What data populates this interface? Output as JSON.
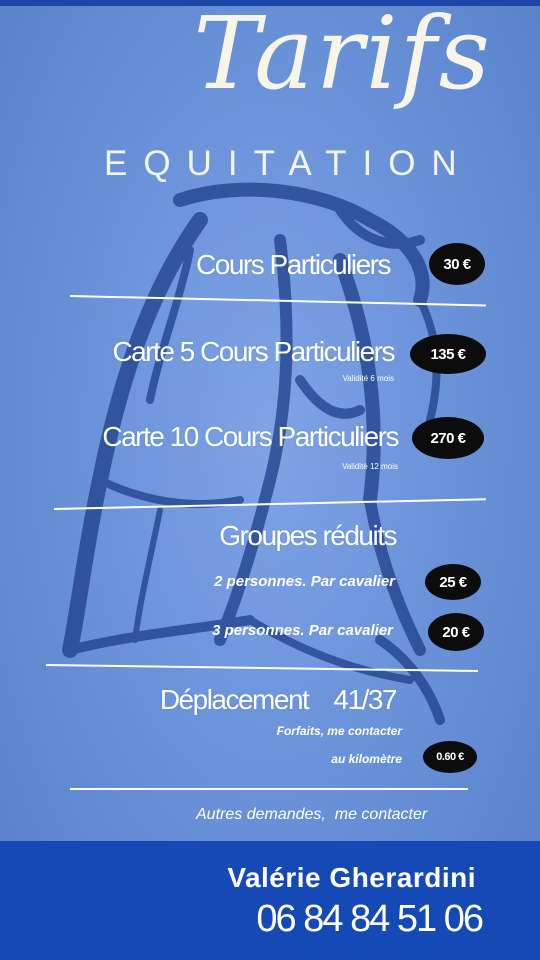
{
  "header": {
    "title": "Tarifs",
    "subtitle": "EQUITATION"
  },
  "prices": [
    {
      "label": "Cours Particuliers",
      "price": "30 €"
    },
    {
      "label": "Carte 5 Cours Particuliers",
      "price": "135 €",
      "note": "Validité 6 mois"
    },
    {
      "label": "Carte 10 Cours Particuliers",
      "price": "270 €",
      "note": "Validité 12 mois"
    }
  ],
  "groups": {
    "label": "Groupes réduits",
    "options": [
      {
        "label": "2  personnes.  Par cavalier",
        "price": "25 €"
      },
      {
        "label": "3  personnes.  Par cavalier",
        "price": "20 €"
      }
    ]
  },
  "travel": {
    "label": "Déplacement    41/37",
    "note": "Forfaits, me contacter",
    "km_label": "au kilomètre",
    "km_price": "0.60 €"
  },
  "footer": {
    "note": "Autres demandes,  me contacter",
    "name": "Valérie Gherardini",
    "phone": "06 84 84 51 06"
  },
  "colors": {
    "background": "#6b93da",
    "footer_band": "#1549b5",
    "badge": "#0c0c0c",
    "horse": "#1e3f8a"
  },
  "icons": {
    "background_art": "horse-head-illustration"
  }
}
